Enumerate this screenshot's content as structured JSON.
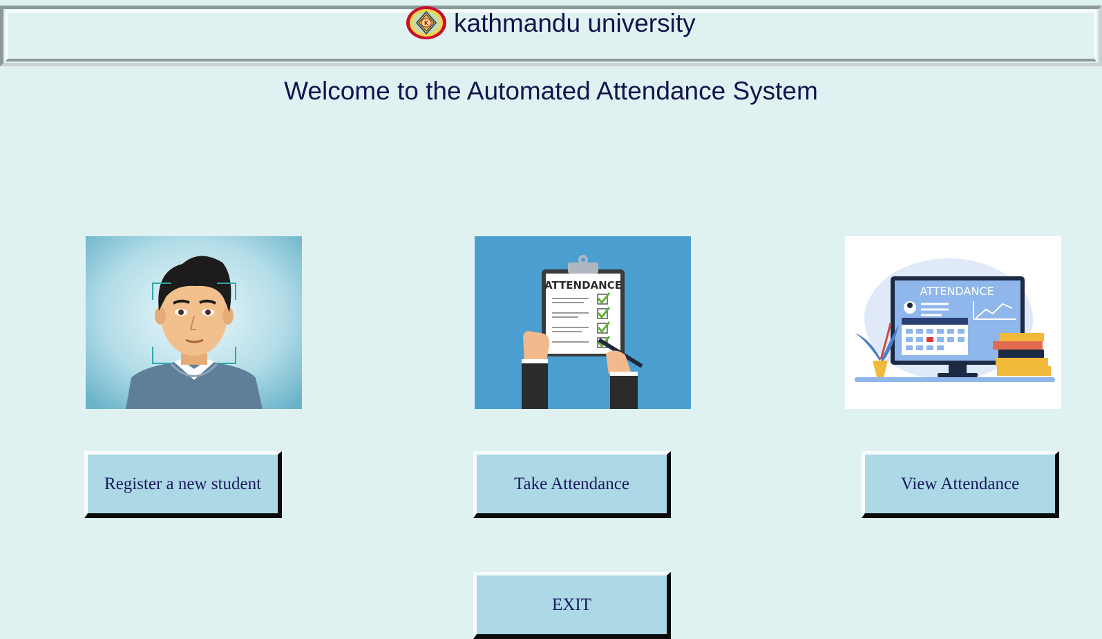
{
  "header": {
    "university_name": "kathmandu university",
    "logo_icon": "university-seal-icon"
  },
  "welcome_text": "Welcome to the Automated Attendance System",
  "cards": [
    {
      "image_icon": "face-recognition-icon",
      "button_label": "Register a new student"
    },
    {
      "image_icon": "attendance-clipboard-icon",
      "image_text": "ATTENDANCE",
      "button_label": "Take Attendance"
    },
    {
      "image_icon": "attendance-monitor-icon",
      "image_text": "ATTENDANCE",
      "button_label": "View Attendance"
    }
  ],
  "exit_label": "EXIT",
  "colors": {
    "background": "#e0f1f1",
    "button": "#add8e6",
    "text": "#14144d"
  }
}
